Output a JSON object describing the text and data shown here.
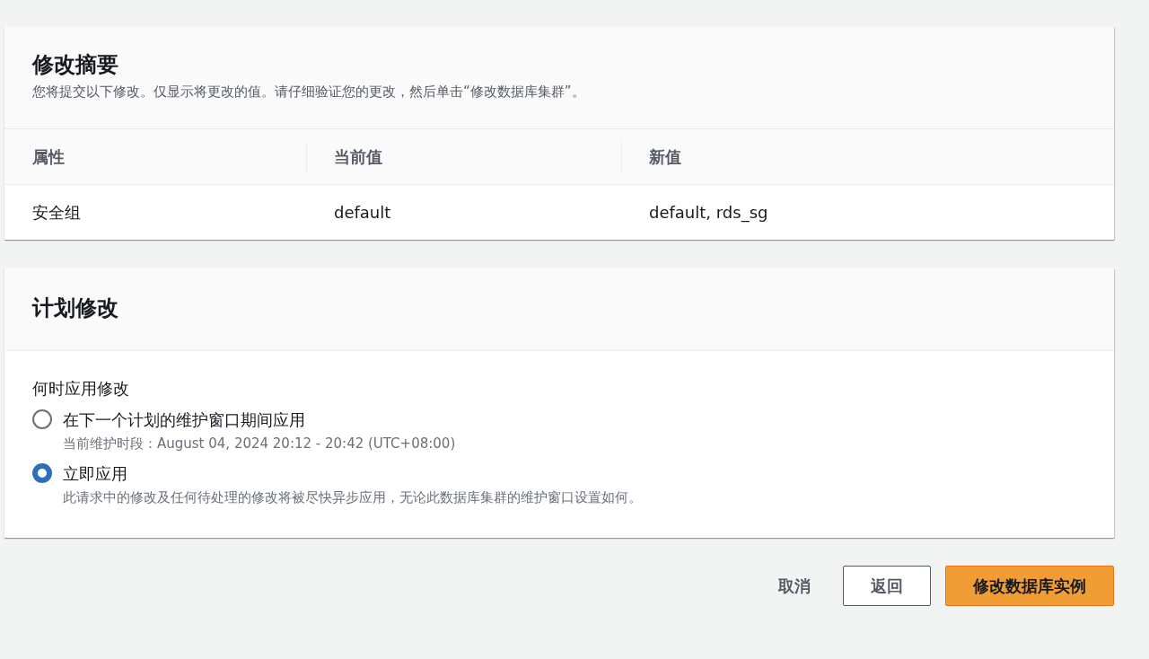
{
  "summary": {
    "title": "修改摘要",
    "description": "您将提交以下修改。仅显示将更改的值。请仔细验证您的更改，然后单击“修改数据库集群”。",
    "columns": [
      "属性",
      "当前值",
      "新值"
    ],
    "rows": [
      [
        "安全组",
        "default",
        "default, rds_sg"
      ]
    ]
  },
  "schedule": {
    "title": "计划修改",
    "question": "何时应用修改",
    "options": [
      {
        "label": "在下一个计划的维护窗口期间应用",
        "description": "当前维护时段：August 04, 2024 20:12 - 20:42 (UTC+08:00)",
        "selected": false
      },
      {
        "label": "立即应用",
        "description": "此请求中的修改及任何待处理的修改将被尽快异步应用，无论此数据库集群的维护窗口设置如何。",
        "selected": true
      }
    ]
  },
  "buttons": [
    {
      "label": "取消",
      "kind": "link"
    },
    {
      "label": "返回",
      "kind": "outline"
    },
    {
      "label": "修改数据库实例",
      "kind": "primary"
    }
  ]
}
